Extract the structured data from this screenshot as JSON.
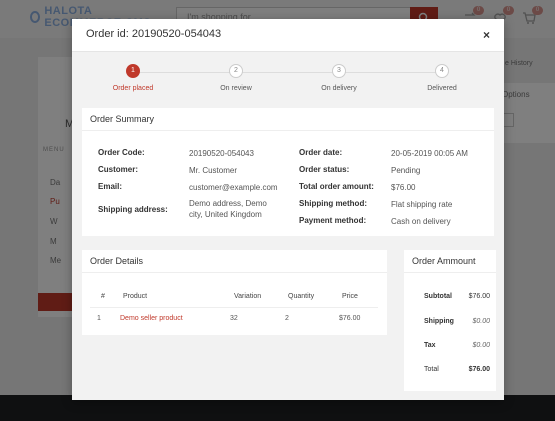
{
  "background": {
    "logo_text": "HALOTA ECOMMERCE CMS",
    "search_placeholder": "I'm shopping for...",
    "badges": [
      "0",
      "0",
      "0"
    ],
    "left_letter": "M",
    "menu_label": "MENU",
    "menu_items": [
      "Da",
      "Pu",
      "W",
      "M",
      "Me"
    ],
    "right_link": "e History",
    "right_options": "Options"
  },
  "modal": {
    "title": "Order id: 20190520-054043",
    "close": "×",
    "steps": [
      {
        "number": "1",
        "label": "Order placed",
        "active": true
      },
      {
        "number": "2",
        "label": "On review",
        "active": false
      },
      {
        "number": "3",
        "label": "On delivery",
        "active": false
      },
      {
        "number": "4",
        "label": "Delivered",
        "active": false
      }
    ],
    "summary": {
      "title": "Order Summary",
      "left": [
        {
          "label": "Order Code:",
          "value": "20190520-054043"
        },
        {
          "label": "Customer:",
          "value": "Mr. Customer"
        },
        {
          "label": "Email:",
          "value": "customer@example.com"
        },
        {
          "label": "Shipping address:",
          "value": "Demo address, Demo city, United Kingdom"
        }
      ],
      "right": [
        {
          "label": "Order date:",
          "value": "20-05-2019 00:05 AM"
        },
        {
          "label": "Order status:",
          "value": "Pending"
        },
        {
          "label": "Total order amount:",
          "value": "$76.00"
        },
        {
          "label": "Shipping method:",
          "value": "Flat shipping rate"
        },
        {
          "label": "Payment method:",
          "value": "Cash on delivery"
        }
      ]
    },
    "details": {
      "title": "Order Details",
      "headers": [
        "#",
        "Product",
        "Variation",
        "Quantity",
        "Price"
      ],
      "rows": [
        {
          "num": "1",
          "product": "Demo seller product",
          "variation": "32",
          "quantity": "2",
          "price": "$76.00"
        }
      ]
    },
    "amount": {
      "title": "Order Ammount",
      "rows": [
        {
          "label": "Subtotal",
          "value": "$76.00"
        },
        {
          "label": "Shipping",
          "value": "$0.00"
        },
        {
          "label": "Tax",
          "value": "$0.00"
        },
        {
          "label": "Total",
          "value": "$76.00"
        }
      ]
    }
  },
  "colors": {
    "accent": "#c0392b",
    "footer": "#1f2023"
  }
}
